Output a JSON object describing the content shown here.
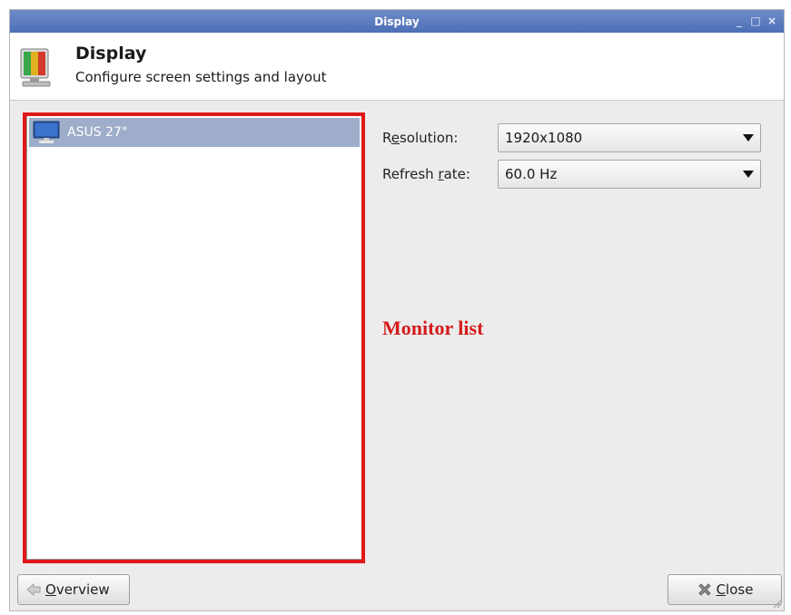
{
  "window": {
    "title": "Display",
    "controls": [
      "_",
      "□",
      "×"
    ]
  },
  "header": {
    "title": "Display",
    "subtitle": "Configure screen settings and layout",
    "icon": "display-settings-icon"
  },
  "monitor_list": {
    "items": [
      {
        "label": "ASUS 27\"",
        "icon": "monitor-icon",
        "selected": true
      }
    ]
  },
  "settings": {
    "resolution": {
      "label": "Resolution:",
      "mnemonic": "e",
      "value": "1920x1080"
    },
    "refresh_rate": {
      "label": "Refresh rate:",
      "mnemonic": "r",
      "value": "60.0 Hz"
    }
  },
  "annotation": {
    "text": "Monitor list",
    "color": "#d61a1a"
  },
  "buttons": {
    "overview": {
      "label": "Overview",
      "mnemonic": "O",
      "icon": "back-arrow-icon"
    },
    "close": {
      "label": "Close",
      "mnemonic": "C",
      "icon": "close-x-icon"
    }
  },
  "colors": {
    "titlebar": "#4c6fb6",
    "selection": "#9eadc9",
    "highlight_outline": "#e01818"
  }
}
